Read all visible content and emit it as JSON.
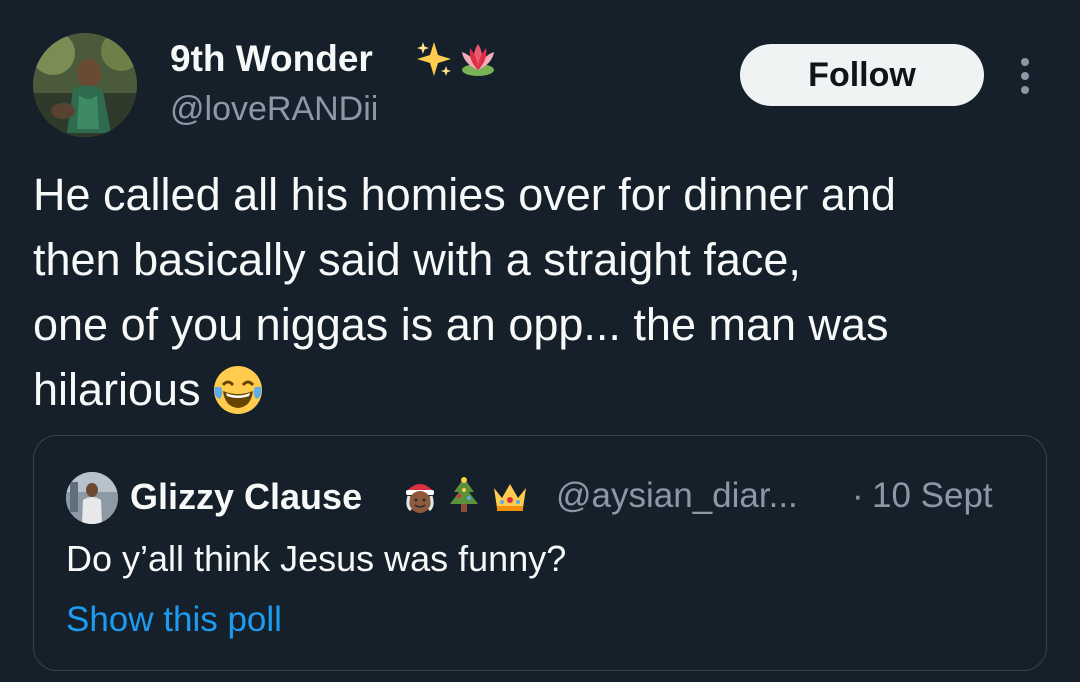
{
  "tweet": {
    "author": {
      "display_name": "9th Wonder",
      "name_emojis": [
        "sparkles-icon",
        "lotus-icon"
      ],
      "handle": "@loveRANDii"
    },
    "follow_label": "Follow",
    "text_lines": [
      "He called all his homies over for dinner and",
      "then basically said with a straight face,",
      "one of you niggas is an opp... the man was",
      "hilarious"
    ],
    "text_trailing_emoji": "face-with-tears-of-joy-icon"
  },
  "quoted_tweet": {
    "author": {
      "display_name": "Glizzy Clause",
      "name_emojis": [
        "mrs-claus-icon",
        "christmas-tree-icon",
        "crown-icon"
      ],
      "handle": "@aysian_diar..."
    },
    "separator": "·",
    "date": "10 Sept",
    "text": "Do y’all think Jesus was funny?",
    "poll_link_label": "Show this poll"
  },
  "colors": {
    "background": "#15202b",
    "primary_text": "#f7f9f9",
    "secondary_text": "#8b98a5",
    "link": "#1d9bf0",
    "border": "#38444d",
    "follow_button_bg": "#eff3f4"
  }
}
